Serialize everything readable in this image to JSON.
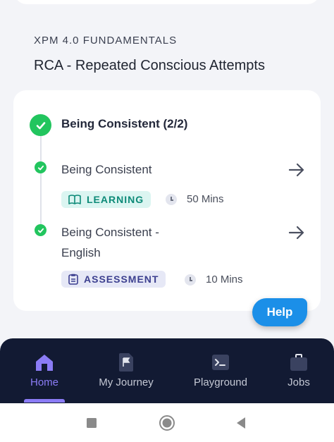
{
  "course": {
    "label": "XPM 4.0 FUNDAMENTALS",
    "title": "RCA - Repeated Conscious Attempts"
  },
  "section": {
    "title": "Being Consistent (2/2)",
    "items": [
      {
        "title": "Being Consistent",
        "badge": "LEARNING",
        "duration": "50 Mins"
      },
      {
        "title_line1": "Being Consistent -",
        "title_line2": "English",
        "badge": "ASSESSMENT",
        "duration": "10 Mins"
      }
    ]
  },
  "help": {
    "label": "Help"
  },
  "nav": {
    "items": [
      {
        "label": "Home",
        "icon": "home-icon",
        "active": true
      },
      {
        "label": "My Journey",
        "icon": "flag-icon",
        "active": false
      },
      {
        "label": "Playground",
        "icon": "terminal-icon",
        "active": false
      },
      {
        "label": "Jobs",
        "icon": "briefcase-icon",
        "active": false
      }
    ]
  },
  "colors": {
    "accent": "#8b7cf6",
    "success": "#22c55e",
    "help": "#1b8fe8",
    "nav_bg": "#121a33"
  }
}
